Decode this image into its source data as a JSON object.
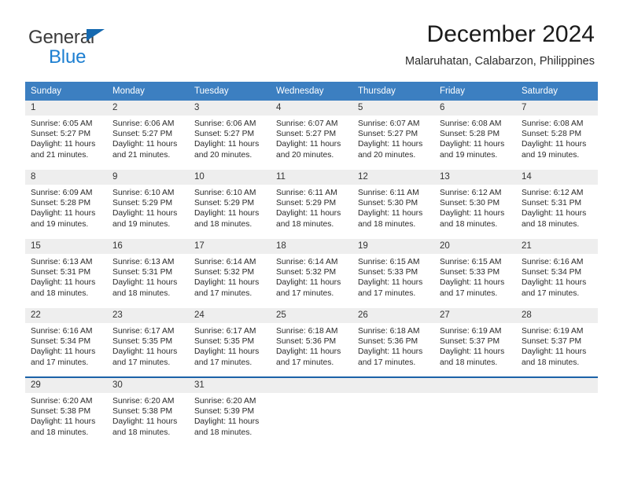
{
  "brand": {
    "line1": "General",
    "line2": "Blue",
    "triangle_color": "#1569b0",
    "blue_text_color": "#1d7fd1"
  },
  "header": {
    "title": "December 2024",
    "subtitle": "Malaruhatan, Calabarzon, Philippines"
  },
  "theme": {
    "header_bg": "#3c7fc1",
    "header_text": "#ffffff",
    "daynum_bg": "#eeeeee",
    "grid_line": "#9fb9d4",
    "last_row_line": "#1b62a8"
  },
  "weekday_headers": [
    "Sunday",
    "Monday",
    "Tuesday",
    "Wednesday",
    "Thursday",
    "Friday",
    "Saturday"
  ],
  "weeks": [
    [
      {
        "day": "1",
        "sunrise": "Sunrise: 6:05 AM",
        "sunset": "Sunset: 5:27 PM",
        "daylight1": "Daylight: 11 hours",
        "daylight2": "and 21 minutes."
      },
      {
        "day": "2",
        "sunrise": "Sunrise: 6:06 AM",
        "sunset": "Sunset: 5:27 PM",
        "daylight1": "Daylight: 11 hours",
        "daylight2": "and 21 minutes."
      },
      {
        "day": "3",
        "sunrise": "Sunrise: 6:06 AM",
        "sunset": "Sunset: 5:27 PM",
        "daylight1": "Daylight: 11 hours",
        "daylight2": "and 20 minutes."
      },
      {
        "day": "4",
        "sunrise": "Sunrise: 6:07 AM",
        "sunset": "Sunset: 5:27 PM",
        "daylight1": "Daylight: 11 hours",
        "daylight2": "and 20 minutes."
      },
      {
        "day": "5",
        "sunrise": "Sunrise: 6:07 AM",
        "sunset": "Sunset: 5:27 PM",
        "daylight1": "Daylight: 11 hours",
        "daylight2": "and 20 minutes."
      },
      {
        "day": "6",
        "sunrise": "Sunrise: 6:08 AM",
        "sunset": "Sunset: 5:28 PM",
        "daylight1": "Daylight: 11 hours",
        "daylight2": "and 19 minutes."
      },
      {
        "day": "7",
        "sunrise": "Sunrise: 6:08 AM",
        "sunset": "Sunset: 5:28 PM",
        "daylight1": "Daylight: 11 hours",
        "daylight2": "and 19 minutes."
      }
    ],
    [
      {
        "day": "8",
        "sunrise": "Sunrise: 6:09 AM",
        "sunset": "Sunset: 5:28 PM",
        "daylight1": "Daylight: 11 hours",
        "daylight2": "and 19 minutes."
      },
      {
        "day": "9",
        "sunrise": "Sunrise: 6:10 AM",
        "sunset": "Sunset: 5:29 PM",
        "daylight1": "Daylight: 11 hours",
        "daylight2": "and 19 minutes."
      },
      {
        "day": "10",
        "sunrise": "Sunrise: 6:10 AM",
        "sunset": "Sunset: 5:29 PM",
        "daylight1": "Daylight: 11 hours",
        "daylight2": "and 18 minutes."
      },
      {
        "day": "11",
        "sunrise": "Sunrise: 6:11 AM",
        "sunset": "Sunset: 5:29 PM",
        "daylight1": "Daylight: 11 hours",
        "daylight2": "and 18 minutes."
      },
      {
        "day": "12",
        "sunrise": "Sunrise: 6:11 AM",
        "sunset": "Sunset: 5:30 PM",
        "daylight1": "Daylight: 11 hours",
        "daylight2": "and 18 minutes."
      },
      {
        "day": "13",
        "sunrise": "Sunrise: 6:12 AM",
        "sunset": "Sunset: 5:30 PM",
        "daylight1": "Daylight: 11 hours",
        "daylight2": "and 18 minutes."
      },
      {
        "day": "14",
        "sunrise": "Sunrise: 6:12 AM",
        "sunset": "Sunset: 5:31 PM",
        "daylight1": "Daylight: 11 hours",
        "daylight2": "and 18 minutes."
      }
    ],
    [
      {
        "day": "15",
        "sunrise": "Sunrise: 6:13 AM",
        "sunset": "Sunset: 5:31 PM",
        "daylight1": "Daylight: 11 hours",
        "daylight2": "and 18 minutes."
      },
      {
        "day": "16",
        "sunrise": "Sunrise: 6:13 AM",
        "sunset": "Sunset: 5:31 PM",
        "daylight1": "Daylight: 11 hours",
        "daylight2": "and 18 minutes."
      },
      {
        "day": "17",
        "sunrise": "Sunrise: 6:14 AM",
        "sunset": "Sunset: 5:32 PM",
        "daylight1": "Daylight: 11 hours",
        "daylight2": "and 17 minutes."
      },
      {
        "day": "18",
        "sunrise": "Sunrise: 6:14 AM",
        "sunset": "Sunset: 5:32 PM",
        "daylight1": "Daylight: 11 hours",
        "daylight2": "and 17 minutes."
      },
      {
        "day": "19",
        "sunrise": "Sunrise: 6:15 AM",
        "sunset": "Sunset: 5:33 PM",
        "daylight1": "Daylight: 11 hours",
        "daylight2": "and 17 minutes."
      },
      {
        "day": "20",
        "sunrise": "Sunrise: 6:15 AM",
        "sunset": "Sunset: 5:33 PM",
        "daylight1": "Daylight: 11 hours",
        "daylight2": "and 17 minutes."
      },
      {
        "day": "21",
        "sunrise": "Sunrise: 6:16 AM",
        "sunset": "Sunset: 5:34 PM",
        "daylight1": "Daylight: 11 hours",
        "daylight2": "and 17 minutes."
      }
    ],
    [
      {
        "day": "22",
        "sunrise": "Sunrise: 6:16 AM",
        "sunset": "Sunset: 5:34 PM",
        "daylight1": "Daylight: 11 hours",
        "daylight2": "and 17 minutes."
      },
      {
        "day": "23",
        "sunrise": "Sunrise: 6:17 AM",
        "sunset": "Sunset: 5:35 PM",
        "daylight1": "Daylight: 11 hours",
        "daylight2": "and 17 minutes."
      },
      {
        "day": "24",
        "sunrise": "Sunrise: 6:17 AM",
        "sunset": "Sunset: 5:35 PM",
        "daylight1": "Daylight: 11 hours",
        "daylight2": "and 17 minutes."
      },
      {
        "day": "25",
        "sunrise": "Sunrise: 6:18 AM",
        "sunset": "Sunset: 5:36 PM",
        "daylight1": "Daylight: 11 hours",
        "daylight2": "and 17 minutes."
      },
      {
        "day": "26",
        "sunrise": "Sunrise: 6:18 AM",
        "sunset": "Sunset: 5:36 PM",
        "daylight1": "Daylight: 11 hours",
        "daylight2": "and 17 minutes."
      },
      {
        "day": "27",
        "sunrise": "Sunrise: 6:19 AM",
        "sunset": "Sunset: 5:37 PM",
        "daylight1": "Daylight: 11 hours",
        "daylight2": "and 18 minutes."
      },
      {
        "day": "28",
        "sunrise": "Sunrise: 6:19 AM",
        "sunset": "Sunset: 5:37 PM",
        "daylight1": "Daylight: 11 hours",
        "daylight2": "and 18 minutes."
      }
    ],
    [
      {
        "day": "29",
        "sunrise": "Sunrise: 6:20 AM",
        "sunset": "Sunset: 5:38 PM",
        "daylight1": "Daylight: 11 hours",
        "daylight2": "and 18 minutes."
      },
      {
        "day": "30",
        "sunrise": "Sunrise: 6:20 AM",
        "sunset": "Sunset: 5:38 PM",
        "daylight1": "Daylight: 11 hours",
        "daylight2": "and 18 minutes."
      },
      {
        "day": "31",
        "sunrise": "Sunrise: 6:20 AM",
        "sunset": "Sunset: 5:39 PM",
        "daylight1": "Daylight: 11 hours",
        "daylight2": "and 18 minutes."
      },
      {
        "day": "",
        "sunrise": "",
        "sunset": "",
        "daylight1": "",
        "daylight2": ""
      },
      {
        "day": "",
        "sunrise": "",
        "sunset": "",
        "daylight1": "",
        "daylight2": ""
      },
      {
        "day": "",
        "sunrise": "",
        "sunset": "",
        "daylight1": "",
        "daylight2": ""
      },
      {
        "day": "",
        "sunrise": "",
        "sunset": "",
        "daylight1": "",
        "daylight2": ""
      }
    ]
  ]
}
